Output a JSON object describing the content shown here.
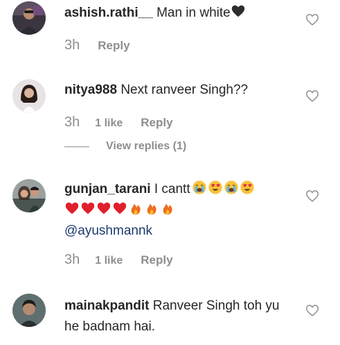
{
  "comments": [
    {
      "username": "ashish.rathi__",
      "text": "Man in white",
      "emojis": [
        "black-heart"
      ],
      "time": "3h",
      "likes": "",
      "reply_label": "Reply"
    },
    {
      "username": "nitya988",
      "text": "Next ranveer Singh??",
      "emojis": [],
      "time": "3h",
      "likes": "1 like",
      "reply_label": "Reply",
      "view_replies_label": "View replies (1)"
    },
    {
      "username": "gunjan_tarani",
      "text": "I cantt",
      "emojis": [
        "crying-face",
        "heart-eyes-face",
        "crying-face",
        "heart-eyes-face"
      ],
      "emojis_line2": [
        "red-heart",
        "red-heart",
        "red-heart",
        "red-heart",
        "fire",
        "fire",
        "fire"
      ],
      "mention": "@ayushmannk",
      "time": "3h",
      "likes": "1 like",
      "reply_label": "Reply"
    },
    {
      "username": "mainakpandit",
      "text": "Ranveer Singh toh yu he badnam hai.",
      "time": "",
      "likes": "",
      "reply_label": ""
    }
  ],
  "colors": {
    "text": "#262626",
    "muted": "#8e8e8e",
    "mention": "#1e3a6e"
  },
  "icons": {
    "like": "heart-outline-icon"
  }
}
